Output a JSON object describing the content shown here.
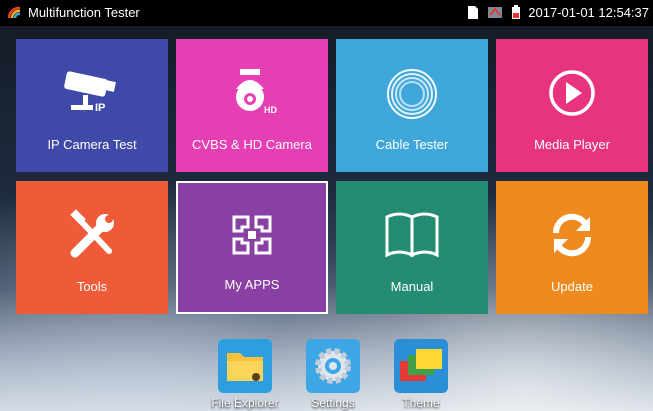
{
  "statusbar": {
    "title": "Multifunction Tester",
    "datetime": "2017-01-01 12:54:37",
    "icons": [
      "sd-card-icon",
      "network-icon",
      "battery-icon"
    ]
  },
  "tiles": [
    {
      "name": "tile-ip-camera-test",
      "label": "IP Camera Test",
      "color": "#3f4aa8",
      "icon": "cctv-camera-icon"
    },
    {
      "name": "tile-cvbs-hd-camera",
      "label": "CVBS & HD Camera",
      "color": "#e63fb4",
      "icon": "ptz-dome-camera-icon"
    },
    {
      "name": "tile-cable-tester",
      "label": "Cable Tester",
      "color": "#3fa6d9",
      "icon": "cable-coil-icon"
    },
    {
      "name": "tile-media-player",
      "label": "Media Player",
      "color": "#e8337e",
      "icon": "play-icon"
    },
    {
      "name": "tile-tools",
      "label": "Tools",
      "color": "#ef5a39",
      "icon": "tools-icon"
    },
    {
      "name": "tile-my-apps",
      "label": "My APPS",
      "color": "#8a3fa3",
      "icon": "apps-icon",
      "selected": true
    },
    {
      "name": "tile-manual",
      "label": "Manual",
      "color": "#238c73",
      "icon": "book-icon"
    },
    {
      "name": "tile-update",
      "label": "Update",
      "color": "#ef8a1f",
      "icon": "refresh-icon"
    }
  ],
  "dock": [
    {
      "name": "dock-file-explorer",
      "label": "File Explorer",
      "icon": "folder-icon"
    },
    {
      "name": "dock-settings",
      "label": "Settings",
      "icon": "gear-icon"
    },
    {
      "name": "dock-theme",
      "label": "Theme",
      "icon": "theme-icon"
    }
  ]
}
